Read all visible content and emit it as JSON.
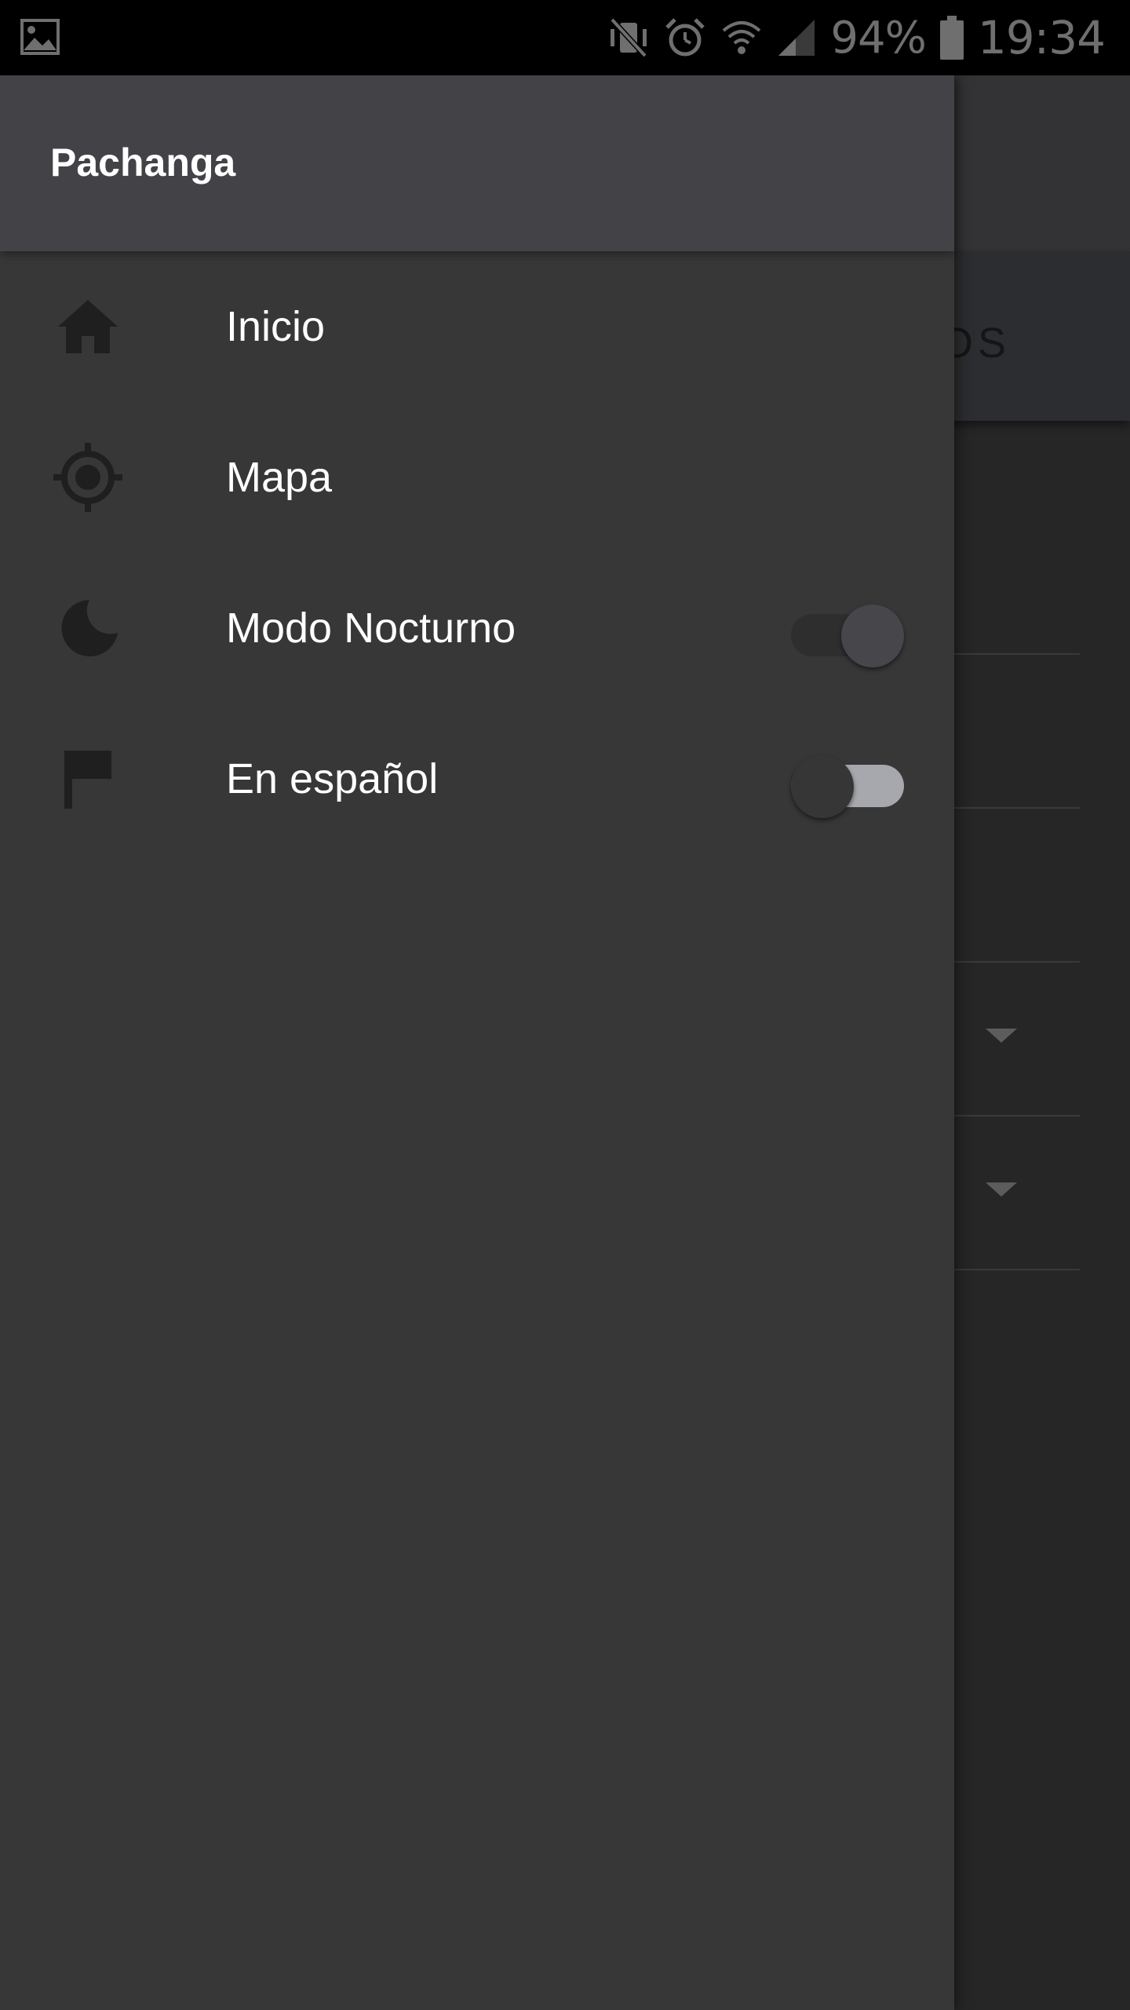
{
  "status_bar": {
    "battery": "94%",
    "time": "19:34",
    "icons": [
      "gallery-icon",
      "vibrate-mute-icon",
      "alarm-icon",
      "wifi-icon",
      "signal-icon",
      "battery-icon"
    ]
  },
  "background_app": {
    "tab_label_fragment": "TOS"
  },
  "drawer": {
    "title": "Pachanga",
    "items": [
      {
        "label": "Inicio",
        "icon": "home-icon"
      },
      {
        "label": "Mapa",
        "icon": "location-target-icon"
      },
      {
        "label": "Modo Nocturno",
        "icon": "moon-icon",
        "toggle": true
      },
      {
        "label": "En español",
        "icon": "flag-icon",
        "toggle": false
      }
    ]
  },
  "colors": {
    "status_bar": "#000000",
    "drawer_header": "#434247",
    "drawer_body": "#373737",
    "icon": "#1f1f1f",
    "text": "#ffffff",
    "switch_on_thumb": "#47464b",
    "switch_off_track": "#a6a8ae"
  }
}
